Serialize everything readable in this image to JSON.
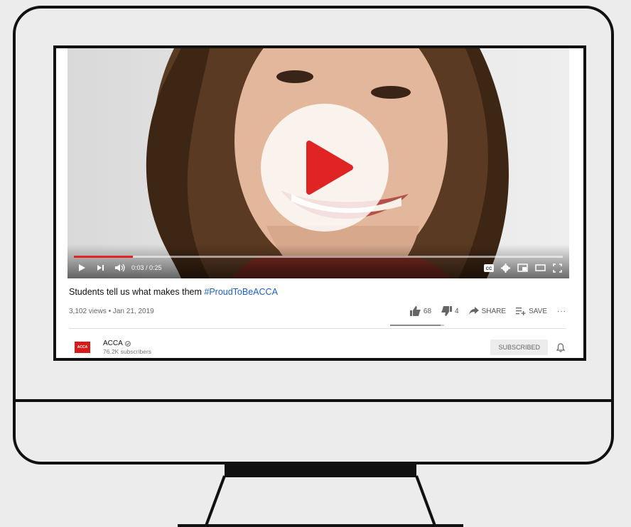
{
  "video": {
    "time_display": "0:03 / 0:25",
    "progress": 0.12,
    "title_plain": "Students tell us what makes them ",
    "title_hashtag": "#ProudToBeACCA",
    "meta": "3,102 views • Jan 21, 2019",
    "likes": "68",
    "dislikes": "4",
    "like_ratio": 0.94,
    "share_label": "SHARE",
    "save_label": "SAVE",
    "more_label": "···"
  },
  "channel": {
    "logo_text": "ACCA",
    "name": "ACCA",
    "subscribers": "76.2K subscribers",
    "subscribe_label": "SUBSCRIBED"
  },
  "colors": {
    "progress": "#e02424",
    "hashtag": "#1a5fd0",
    "logo": "#d81a1a"
  },
  "icons": [
    "play-icon",
    "next-icon",
    "volume-icon",
    "captions-icon",
    "settings-icon",
    "miniplayer-icon",
    "theater-icon",
    "fullscreen-icon",
    "thumbs-up-icon",
    "thumbs-down-icon",
    "share-icon",
    "save-playlist-icon",
    "verified-icon",
    "bell-icon"
  ]
}
